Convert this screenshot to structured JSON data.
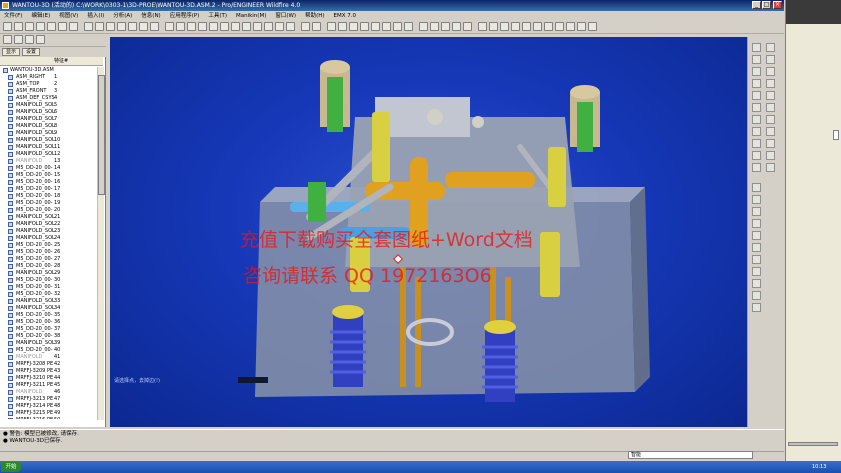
{
  "window": {
    "title": "WANTOU-3D (活动的) C:\\WORK\\0303-1\\3D-PROE\\WANTOU-3D.ASM.2 - Pro/ENGINEER Wildfire 4.0",
    "min": "_",
    "max": "□",
    "close": "×"
  },
  "menu": {
    "items": [
      "文件(F)",
      "编辑(E)",
      "视图(V)",
      "插入(I)",
      "分析(A)",
      "信息(N)",
      "应用程序(P)",
      "工具(T)",
      "Manikin(M)",
      "窗口(W)",
      "帮助(H)",
      "EMX 7.0"
    ]
  },
  "nav": {
    "tabs": [
      "显示",
      "设置"
    ],
    "col_name": "",
    "col_feature": "特征#",
    "items": [
      {
        "label": "WANTOU-3D.ASM",
        "num": ""
      },
      {
        "label": "ASM_RIGHT",
        "num": "1"
      },
      {
        "label": "ASM_TOP",
        "num": "2"
      },
      {
        "label": "ASM_FRONT",
        "num": "3"
      },
      {
        "label": "ASM_DEF_CSYS",
        "num": "4"
      },
      {
        "label": "MANIFOLD_SOL",
        "num": "5"
      },
      {
        "label": "MANIFOLD_SOL",
        "num": "6"
      },
      {
        "label": "MANIFOLD_SOL",
        "num": "7"
      },
      {
        "label": "MANIFOLD_SOL",
        "num": "8"
      },
      {
        "label": "MANIFOLD_SOL",
        "num": "9"
      },
      {
        "label": "MANIFOLD_SOL",
        "num": "10"
      },
      {
        "label": "MANIFOLD_SOL",
        "num": "11"
      },
      {
        "label": "MANIFOLD_SOL",
        "num": "12"
      },
      {
        "label": "MANIFOLD",
        "num": "13"
      },
      {
        "label": "M5_DD-20_00-",
        "num": "14"
      },
      {
        "label": "M5_DD-20_00-",
        "num": "15"
      },
      {
        "label": "M5_DD-20_00-",
        "num": "16"
      },
      {
        "label": "M5_DD-20_00-",
        "num": "17"
      },
      {
        "label": "M5_DD-20_00-",
        "num": "18"
      },
      {
        "label": "M5_DD-20_00-",
        "num": "19"
      },
      {
        "label": "M5_DD-20_00-",
        "num": "20"
      },
      {
        "label": "MANIFOLD_SOL",
        "num": "21"
      },
      {
        "label": "MANIFOLD_SOL",
        "num": "22"
      },
      {
        "label": "MANIFOLD_SOL",
        "num": "23"
      },
      {
        "label": "MANIFOLD_SOL",
        "num": "24"
      },
      {
        "label": "M5_DD-20_00-",
        "num": "25"
      },
      {
        "label": "M5_DD-20_00-",
        "num": "26"
      },
      {
        "label": "M5_DD-20_00-",
        "num": "27"
      },
      {
        "label": "M5_DD-20_00-",
        "num": "28"
      },
      {
        "label": "MANIFOLD_SOL",
        "num": "29"
      },
      {
        "label": "M5_DD-20_00-",
        "num": "30"
      },
      {
        "label": "M5_DD-20_00-",
        "num": "31"
      },
      {
        "label": "M5_DD-20_00-",
        "num": "32"
      },
      {
        "label": "MANIFOLD_SOL",
        "num": "33"
      },
      {
        "label": "MANIFOLD_SOL",
        "num": "34"
      },
      {
        "label": "M5_DD-20_00-",
        "num": "35"
      },
      {
        "label": "M5_DD-20_00-",
        "num": "36"
      },
      {
        "label": "M5_DD-20_00-",
        "num": "37"
      },
      {
        "label": "M5_DD-20_00-",
        "num": "38"
      },
      {
        "label": "MANIFOLD_SOL",
        "num": "39"
      },
      {
        "label": "M5_DD-20_00-",
        "num": "40"
      },
      {
        "label": "MANIFOLD",
        "num": "41"
      },
      {
        "label": "MRFFJ-3208 PE",
        "num": "42"
      },
      {
        "label": "MRFFJ-3209 PE",
        "num": "43"
      },
      {
        "label": "MRFFJ-3210 PE",
        "num": "44"
      },
      {
        "label": "MRFFJ-3211 PE",
        "num": "45"
      },
      {
        "label": "MANIFOLD",
        "num": "46"
      },
      {
        "label": "MRFFJ-3213 PE",
        "num": "47"
      },
      {
        "label": "MRFFJ-3214 PE",
        "num": "48"
      },
      {
        "label": "MRFFJ-3215 PE",
        "num": "49"
      },
      {
        "label": "MRFFJ-3216 PE",
        "num": "50"
      }
    ]
  },
  "viewport": {
    "watermark_line1": "充值下载购买全套图纸+Word文档",
    "watermark_line2": "咨询请联系 QQ 1972163O6",
    "hint": "请选择点，去掉边(!)"
  },
  "status": {
    "line1": "● 警告: 模型已被修改, 请保存.",
    "line2": "● WANTOU-3D已保存."
  },
  "filter": {
    "value": "智能"
  },
  "taskbar": {
    "start": "开始",
    "clock": "10:13"
  },
  "colors": {
    "viewport_bg": "#1a3fc0",
    "title_bg": "#0a246a",
    "watermark": "#eb1414"
  }
}
